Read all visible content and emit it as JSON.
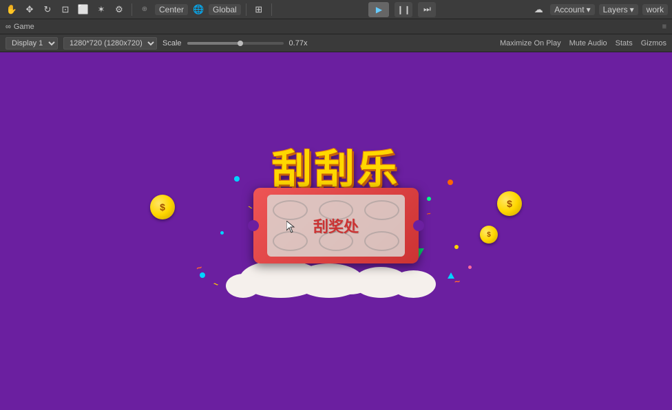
{
  "toolbar": {
    "center_label": "Center",
    "global_label": "Global",
    "play_label": "▶",
    "pause_label": "❙❙",
    "step_label": "⏭",
    "account_label": "Account",
    "layers_label": "Layers",
    "work_label": "work"
  },
  "gamebar": {
    "icon": "∞",
    "title": "Game",
    "close_hint": "×"
  },
  "displaybar": {
    "display_option": "Display 1",
    "resolution_option": "1280*720 (1280x720)",
    "scale_label": "Scale",
    "scale_value": "0.77x",
    "maximize_label": "Maximize On Play",
    "mute_label": "Mute Audio",
    "stats_label": "Stats",
    "gizmos_label": "Gizmos"
  },
  "game": {
    "title_text": "刮刮乐",
    "ticket_text": "刮奖处",
    "bg_color": "#6b1fa0"
  },
  "colors": {
    "toolbar_bg": "#3c3c3c",
    "game_bg": "#6b1fa0",
    "gold": "#FFD700",
    "ticket_red": "#cc3333",
    "cloud_white": "#f5f0ec"
  }
}
